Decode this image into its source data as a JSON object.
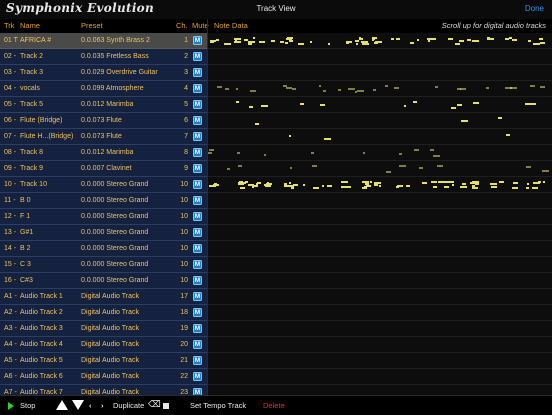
{
  "app": {
    "logo": "Symphonix Evolution",
    "title": "Track View",
    "done_label": "Done"
  },
  "columns": {
    "trk": "Trk",
    "name": "Name",
    "preset": "Preset",
    "ch": "Ch.",
    "mute": "Mute",
    "note": "Note Data",
    "scroll_hint": "Scroll up for digital audio tracks"
  },
  "tracks": [
    {
      "trk": "01 T",
      "name": "AFRICA  #",
      "preset": "0.0.063 Synth Brass 2",
      "ch": "1",
      "mute": "M",
      "selected": true
    },
    {
      "trk": "02 -",
      "name": "Track 2",
      "preset": "0.0.035 Fretless Bass",
      "ch": "2",
      "mute": "M"
    },
    {
      "trk": "03 -",
      "name": "Track 3",
      "preset": "0.0.029 Overdrive Guitar",
      "ch": "3",
      "mute": "M"
    },
    {
      "trk": "04 -",
      "name": "vocals",
      "preset": "0.0.099 Atmosphere",
      "ch": "4",
      "mute": "M"
    },
    {
      "trk": "05 -",
      "name": "Track 5",
      "preset": "0.0.012 Marimba",
      "ch": "5",
      "mute": "M"
    },
    {
      "trk": "06 -",
      "name": "Flute (Bridge)",
      "preset": "0.0.073 Flute",
      "ch": "6",
      "mute": "M"
    },
    {
      "trk": "07 -",
      "name": "Flute H...(Bridge)",
      "preset": "0.0.073 Flute",
      "ch": "7",
      "mute": "M"
    },
    {
      "trk": "08 -",
      "name": "Track 8",
      "preset": "0.0.012 Marimba",
      "ch": "8",
      "mute": "M"
    },
    {
      "trk": "09 -",
      "name": "Track 9",
      "preset": "0.0.007 Clavinet",
      "ch": "9",
      "mute": "M"
    },
    {
      "trk": "10 -",
      "name": "Track 10",
      "preset": "0.0.000 Stereo Grand",
      "ch": "10",
      "mute": "M"
    },
    {
      "trk": "11 -",
      "name": "B 0",
      "preset": "0.0.000 Stereo Grand",
      "ch": "10",
      "mute": "M"
    },
    {
      "trk": "12 -",
      "name": "F 1",
      "preset": "0.0.000 Stereo Grand",
      "ch": "10",
      "mute": "M"
    },
    {
      "trk": "13 -",
      "name": "G#1",
      "preset": "0.0.000 Stereo Grand",
      "ch": "10",
      "mute": "M"
    },
    {
      "trk": "14 -",
      "name": "B 2",
      "preset": "0.0.000 Stereo Grand",
      "ch": "10",
      "mute": "M"
    },
    {
      "trk": "15 -",
      "name": "C 3",
      "preset": "0.0.000 Stereo Grand",
      "ch": "10",
      "mute": "M"
    },
    {
      "trk": "16 -",
      "name": "C#3",
      "preset": "0.0.000 Stereo Grand",
      "ch": "10",
      "mute": "M"
    },
    {
      "trk": "A1 -",
      "name": "Audio Track 1",
      "preset": "Digital Audio Track",
      "ch": "17",
      "mute": "M"
    },
    {
      "trk": "A2 -",
      "name": "Audio Track 2",
      "preset": "Digital Audio Track",
      "ch": "18",
      "mute": "M"
    },
    {
      "trk": "A3 -",
      "name": "Audio Track 3",
      "preset": "Digital Audio Track",
      "ch": "19",
      "mute": "M"
    },
    {
      "trk": "A4 -",
      "name": "Audio Track 4",
      "preset": "Digital Audio Track",
      "ch": "20",
      "mute": "M"
    },
    {
      "trk": "A5 -",
      "name": "Audio Track 5",
      "preset": "Digital Audio Track",
      "ch": "21",
      "mute": "M"
    },
    {
      "trk": "A6 -",
      "name": "Audio Track 6",
      "preset": "Digital Audio Track",
      "ch": "22",
      "mute": "M"
    },
    {
      "trk": "A7 -",
      "name": "Audio Track 7",
      "preset": "Digital Audio Track",
      "ch": "23",
      "mute": "M"
    }
  ],
  "toolbar": {
    "stop": "Stop",
    "duplicate": "Duplicate",
    "set_tempo": "Set Tempo Track",
    "delete": "Delete"
  },
  "colors": {
    "accent": "#e0a030",
    "link": "#3a8ff0",
    "delete": "#e03030",
    "note": "#e6e06a",
    "play": "#2fd02f"
  }
}
